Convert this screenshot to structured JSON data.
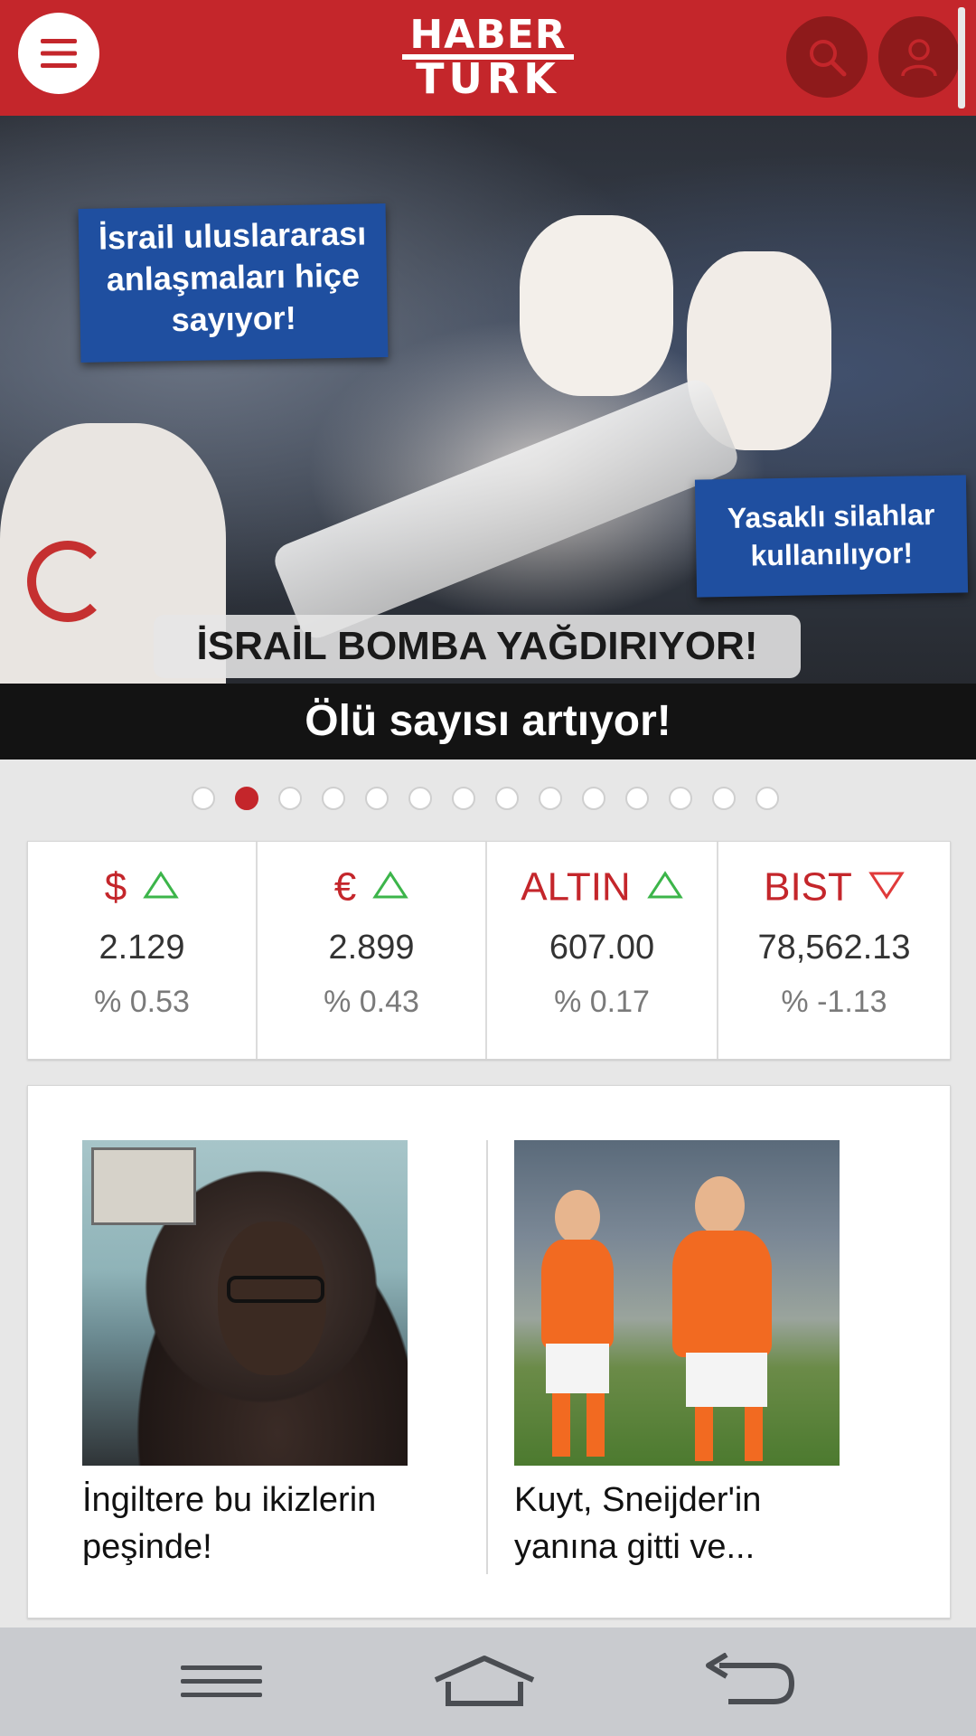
{
  "header": {
    "logo_line1": "HABER",
    "logo_line2": "TURK",
    "brand_color": "#c4262b"
  },
  "hero": {
    "banner_left": "İsrail uluslararası anlaşmaları hiçe sayıyor!",
    "banner_right": "Yasaklı silahlar kullanılıyor!",
    "headline": "İSRAİL BOMBA YAĞDIRIYOR!",
    "subline": "Ölü sayısı artıyor!"
  },
  "carousel": {
    "count": 14,
    "active_index": 1
  },
  "market": [
    {
      "symbol": "$",
      "value": "2.129",
      "change": "% 0.53",
      "direction": "up"
    },
    {
      "symbol": "€",
      "value": "2.899",
      "change": "% 0.43",
      "direction": "up"
    },
    {
      "symbol": "ALTIN",
      "value": "607.00",
      "change": "% 0.17",
      "direction": "up"
    },
    {
      "symbol": "BIST",
      "value": "78,562.13",
      "change": "% -1.13",
      "direction": "down"
    }
  ],
  "news": [
    {
      "title": "İngiltere bu ikizlerin peşinde!"
    },
    {
      "title": "Kuyt, Sneijder'in yanına gitti ve..."
    }
  ],
  "colors": {
    "up": "#3cb54a",
    "down": "#e03a3a",
    "navbar": "#c9cbcf"
  }
}
